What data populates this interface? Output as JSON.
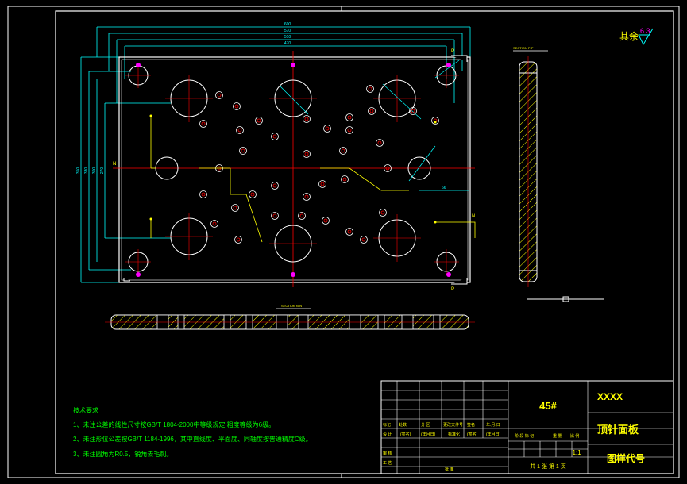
{
  "drawing": {
    "surface_symbol": {
      "prefix": "其余",
      "value": "6.3"
    },
    "section_labels": {
      "side": "SECTION P-P",
      "bottom": "SECTION N-N"
    },
    "cut_marks": {
      "top_right": "P",
      "bottom_right": "P",
      "left": "N",
      "right": "N"
    },
    "dimensions": {
      "h1": "600",
      "h2": "570",
      "h3": "510",
      "h4": "470",
      "v1": "350",
      "v2": "330",
      "v3": "300",
      "v4": "270",
      "small_right": "66"
    }
  },
  "notes": {
    "title": "技术要求",
    "lines": [
      "1、未注公差的线性尺寸按GB/T 1804-2000中等级规定,粗度等级为6级。",
      "2、未注形位公差按GB/T 1184-1996，其中直线度、平面度、同轴度按普通精度C级。",
      "3、未注圆角为R0.5，锐角去毛刺。"
    ]
  },
  "title_block": {
    "material": "45#",
    "company": "XXXX",
    "part_name": "顶针面板",
    "drawing_code": "图样代号",
    "scale": "1:1",
    "sheets": "共 1 张    第 1 页",
    "row_labels": [
      "标记",
      "处数",
      "分 区",
      "更改文件号",
      "签名",
      "年.月.日"
    ],
    "sign_labels": [
      "设 计",
      "(签名)",
      "(年月日)",
      "标准化",
      "(签名)",
      "(年月日)"
    ],
    "stage_labels": [
      "阶 段 标 记",
      "重 量",
      "比 例"
    ],
    "bottom_labels": [
      "审 核",
      "工 艺",
      "批 准"
    ]
  },
  "colors": {
    "frame": "#ffffff",
    "outline": "#ffffff",
    "dim": "#00ffff",
    "center": "#ff0000",
    "green": "#00ff00",
    "yellow": "#ffff00",
    "magenta": "#ff00ff"
  }
}
